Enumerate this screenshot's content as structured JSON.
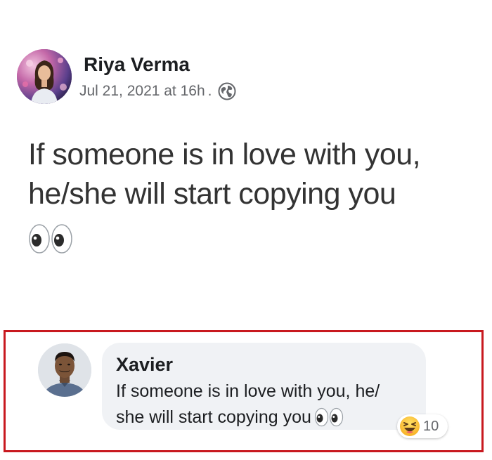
{
  "post": {
    "author_name": "Riya Verma",
    "timestamp": "Jul 21, 2021 at 16h",
    "separator": ".",
    "privacy_icon": "globe-icon",
    "text_lines": [
      "If someone is in love with you,",
      "he/she will start copying you"
    ],
    "emoji": "eyes-emoji"
  },
  "comment": {
    "author_name": "Xavier",
    "text_lines": [
      "If someone is in love with you, he/",
      "she will start copying you"
    ],
    "emoji": "eyes-emoji",
    "reaction": {
      "icon": "laughing-emoji",
      "count": "10"
    }
  },
  "colors": {
    "highlight_border": "#c8191f",
    "bubble_bg": "#f0f2f5",
    "meta_text": "#65676b"
  }
}
